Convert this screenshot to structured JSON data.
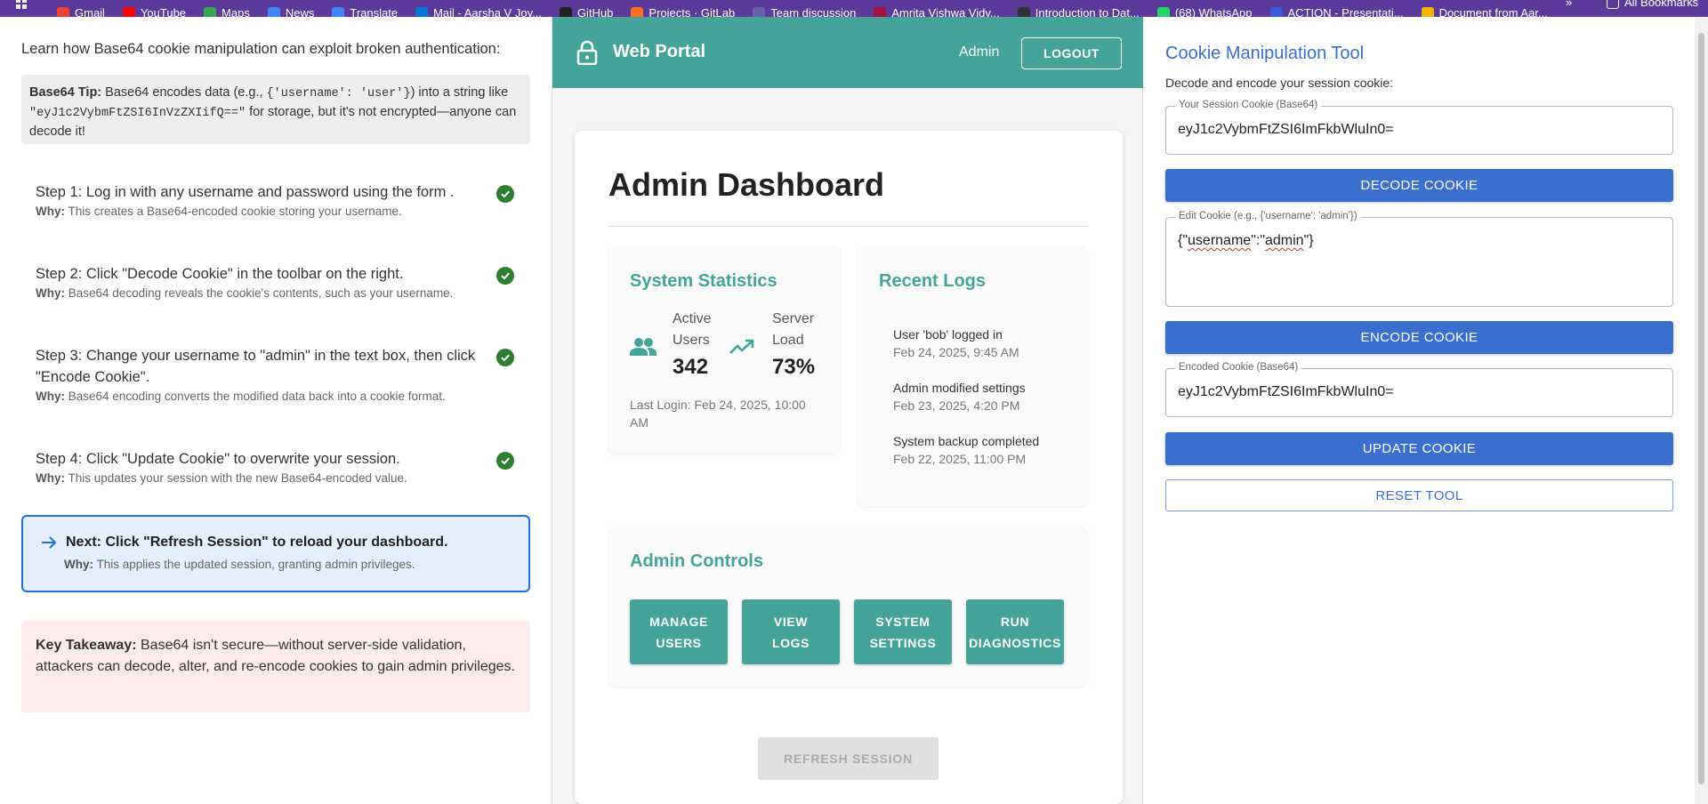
{
  "bookmarks": [
    {
      "label": "Gmail",
      "color": "#ea4335"
    },
    {
      "label": "YouTube",
      "color": "#ff0000"
    },
    {
      "label": "Maps",
      "color": "#34a853"
    },
    {
      "label": "News",
      "color": "#4285f4"
    },
    {
      "label": "Translate",
      "color": "#4285f4"
    },
    {
      "label": "Mail - Aarsha V Joy...",
      "color": "#0078d4"
    },
    {
      "label": "GitHub",
      "color": "#222222"
    },
    {
      "label": "Projects · GitLab",
      "color": "#fc6d26"
    },
    {
      "label": "Team discussion",
      "color": "#6264a7"
    },
    {
      "label": "Amrita Vishwa Vidy...",
      "color": "#a4123f"
    },
    {
      "label": "Introduction to Dat...",
      "color": "#333333"
    },
    {
      "label": "(68) WhatsApp",
      "color": "#25d366"
    },
    {
      "label": "ACTION - Presentati...",
      "color": "#3b5bdb"
    },
    {
      "label": "Document from Aar...",
      "color": "#f4b400"
    }
  ],
  "bookmarks_overflow": "»",
  "all_bookmarks": "All Bookmarks",
  "tutorial": {
    "intro": "Learn how Base64 cookie manipulation can exploit broken authentication:",
    "tip_label": "Base64 Tip:",
    "tip_part1": " Base64 encodes data (e.g., ",
    "tip_code1": "{'username': 'user'}",
    "tip_part2": ") into a string like ",
    "tip_code2": "\"eyJ1c2VybmFtZSI6InVzZXIifQ==\"",
    "tip_part3": " for storage, but it's not encrypted—anyone can decode it!",
    "why_label": "Why:",
    "steps": [
      {
        "title": "Step 1: Log in with any username and password using the form .",
        "why": "This creates a Base64-encoded cookie storing your username."
      },
      {
        "title": "Step 2: Click \"Decode Cookie\" in the toolbar on the right.",
        "why": "Base64 decoding reveals the cookie's contents, such as your username."
      },
      {
        "title": "Step 3: Change your username to \"admin\" in the text box, then click \"Encode Cookie\".",
        "why": "Base64 encoding converts the modified data back into a cookie format."
      },
      {
        "title": "Step 4: Click \"Update Cookie\" to overwrite your session.",
        "why": "This updates your session with the new Base64-encoded value."
      }
    ],
    "next_title": "Next: Click \"Refresh Session\" to reload your dashboard.",
    "next_why": "This applies the updated session, granting admin privileges.",
    "takeaway_label": "Key Takeaway:",
    "takeaway_text": " Base64 isn't secure—without server-side validation, attackers can decode, alter, and re-encode cookies to gain admin privileges."
  },
  "portal": {
    "title": "Web Portal",
    "user": "Admin",
    "logout": "LOGOUT",
    "dashboard_title": "Admin Dashboard",
    "stats": {
      "title": "System Statistics",
      "active_users_label": "Active Users",
      "active_users_value": "342",
      "server_load_label": "Server Load",
      "server_load_value": "73%",
      "last_login": "Last Login: Feb 24, 2025, 10:00 AM"
    },
    "logs": {
      "title": "Recent Logs",
      "items": [
        {
          "text": "User 'bob' logged in",
          "time": "Feb 24, 2025, 9:45 AM"
        },
        {
          "text": "Admin modified settings",
          "time": "Feb 23, 2025, 4:20 PM"
        },
        {
          "text": "System backup completed",
          "time": "Feb 22, 2025, 11:00 PM"
        }
      ]
    },
    "controls": {
      "title": "Admin Controls",
      "buttons": [
        "MANAGE\nUSERS",
        "VIEW\nLOGS",
        "SYSTEM\nSETTINGS",
        "RUN\nDIAGNOSTICS"
      ]
    },
    "refresh": "REFRESH SESSION"
  },
  "tool": {
    "title": "Cookie Manipulation Tool",
    "subtitle": "Decode and encode your session cookie:",
    "session_label": "Your Session Cookie (Base64)",
    "session_value": "eyJ1c2VybmFtZSI6ImFkbWluIn0=",
    "decode": "DECODE COOKIE",
    "edit_label": "Edit Cookie (e.g., {'username': 'admin'})",
    "edit_prefix": "{\"",
    "edit_word1": "username",
    "edit_mid": "\":\"",
    "edit_word2": "admin",
    "edit_suffix": "\"}",
    "encode": "ENCODE COOKIE",
    "encoded_label": "Encoded Cookie (Base64)",
    "encoded_value": "eyJ1c2VybmFtZSI6ImFkbWluIn0=",
    "update": "UPDATE COOKIE",
    "reset": "RESET TOOL"
  },
  "colors": {
    "teal": "#45a497",
    "blue": "#3a6fd0",
    "check_green": "#2e7d32",
    "bookmarks_bar": "#5b3a9a"
  }
}
